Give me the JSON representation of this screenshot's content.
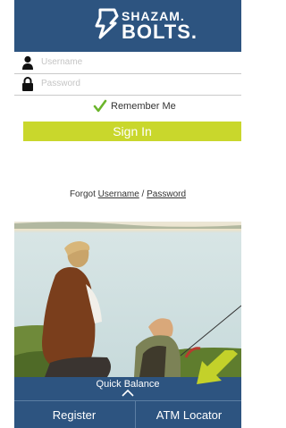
{
  "brand": {
    "top": "SHAZAM.",
    "bottom": "BOLTS."
  },
  "login": {
    "username_placeholder": "Username",
    "password_placeholder": "Password",
    "remember_label": "Remember Me",
    "signin_label": "Sign In"
  },
  "forgot": {
    "prefix": "Forgot ",
    "username": "Username",
    "sep": " / ",
    "password": "Password"
  },
  "quick_balance": {
    "label": "Quick Balance"
  },
  "tabs": {
    "register": "Register",
    "atm_locator": "ATM Locator"
  },
  "colors": {
    "brand_blue": "#2d5480",
    "signin_green": "#c9d72c",
    "arrow_green": "#c3d12a",
    "check_green": "#6bb52b"
  }
}
